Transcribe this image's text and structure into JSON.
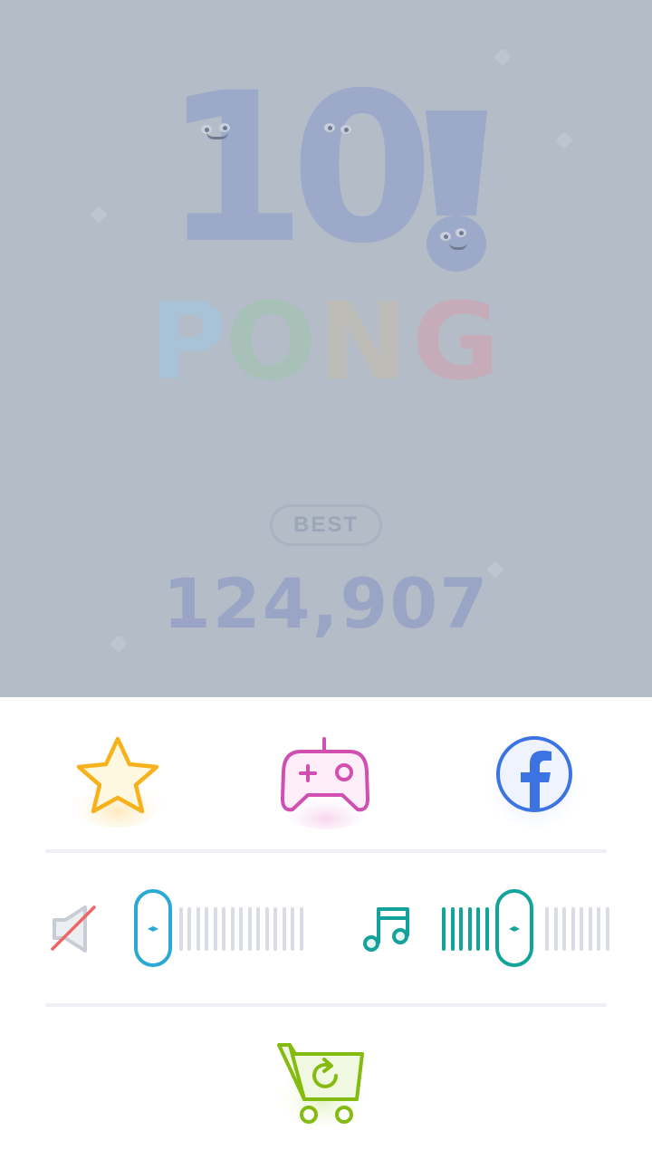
{
  "game": {
    "logo_number": "10",
    "logo_word_letters": [
      "P",
      "O",
      "N",
      "G"
    ],
    "logo_colors": [
      "#a9c2d6",
      "#a7c1b9",
      "#bdbcb6",
      "#c5acb8"
    ],
    "best_label": "BEST",
    "best_score": "124,907"
  },
  "settings": {
    "rate_icon": "star-icon",
    "games_icon": "gamepad-icon",
    "social_icon": "facebook-icon",
    "sound": {
      "icon": "speaker-muted-icon",
      "muted": true,
      "level": 0.0
    },
    "music": {
      "icon": "music-note-icon",
      "muted": false,
      "level": 0.4
    },
    "shop_icon": "shopping-cart-restore-icon",
    "colors": {
      "star": "#f6b21c",
      "gamepad": "#d24fb2",
      "facebook": "#3b73e2",
      "sound": "#29a9d4",
      "music": "#13a39a",
      "muted_slash": "#f06464",
      "cart": "#84bb10",
      "tick_inactive": "#d9dbe5"
    }
  }
}
